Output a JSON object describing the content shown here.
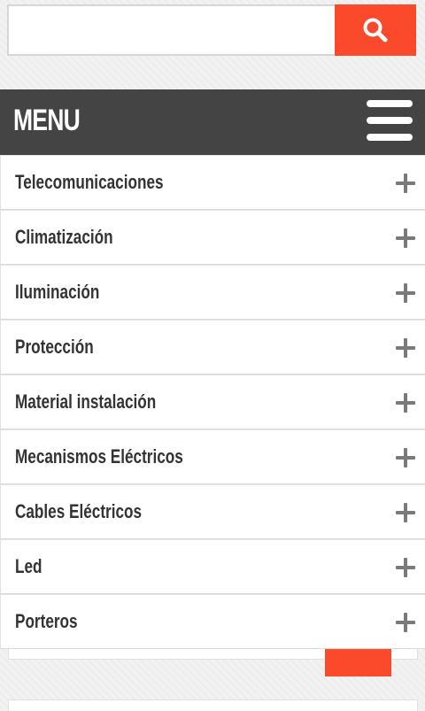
{
  "search": {
    "value": "",
    "placeholder": "",
    "button_icon": "search-icon"
  },
  "menu": {
    "title": "MENU",
    "toggle_icon": "hamburger-icon",
    "expand_icon": "plus-icon",
    "items": [
      {
        "label": "Telecomunicaciones"
      },
      {
        "label": "Climatización"
      },
      {
        "label": "Iluminación"
      },
      {
        "label": "Protección"
      },
      {
        "label": "Material instalación"
      },
      {
        "label": "Mecanismos Eléctricos"
      },
      {
        "label": "Cables Eléctricos"
      },
      {
        "label": "Led"
      },
      {
        "label": "Porteros"
      }
    ]
  },
  "colors": {
    "accent": "#fb4a2b",
    "header_bg": "#444444",
    "item_text": "#333333",
    "icon": "#7a7a7a"
  }
}
